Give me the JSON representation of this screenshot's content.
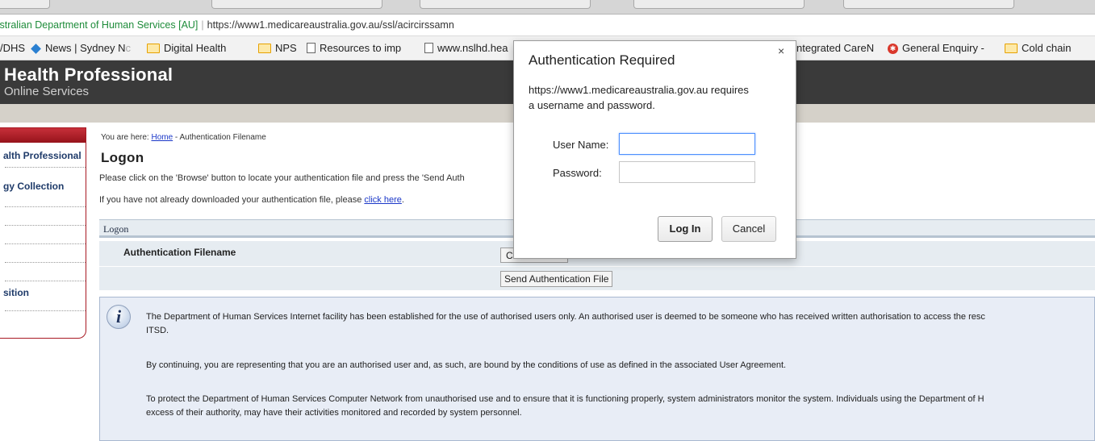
{
  "browser": {
    "site_identity": "ıstralian Department of Human Services [AU]",
    "url": "https://www1.medicareaustralia.gov.au/ssl/acircirssamn",
    "bookmarks": [
      {
        "label": "/DHS",
        "icon": "none"
      },
      {
        "label": "News | Sydney N",
        "fade": "c",
        "icon": "news-diamond-icon"
      },
      {
        "label": "Digital Health",
        "icon": "folder-icon"
      },
      {
        "label": "NPS",
        "icon": "folder-icon"
      },
      {
        "label": "Resources to imp",
        "icon": "page-icon"
      },
      {
        "label": "www.nslhd.hea",
        "icon": "page-icon"
      },
      {
        "label": "ntegrated CareN",
        "icon": "none"
      },
      {
        "label": "General Enquiry -",
        "icon": "red-circle-icon"
      },
      {
        "label": "Cold chain",
        "icon": "folder-icon"
      }
    ]
  },
  "header": {
    "title": "Health Professional",
    "subtitle": "Online Services"
  },
  "leftnav": {
    "items": [
      "alth Professional",
      "gy Collection",
      "sition"
    ]
  },
  "main": {
    "breadcrumb_prefix": "You are here: ",
    "breadcrumb_home": "Home",
    "breadcrumb_rest": " - Authentication Filename",
    "page_title": "Logon",
    "instruction": "Please click on the 'Browse' button to locate your authentication file and press the 'Send Auth",
    "download_prefix": "If you have not already downloaded your authentication file, please ",
    "download_link": "click here",
    "download_suffix": ".",
    "logon_section": "Logon",
    "auth_filename_label": "Authentication Filename",
    "choose_button": "C",
    "send_button": "Send Authentication File"
  },
  "info": {
    "icon": "info-icon",
    "para1_line1": "The Department of Human Services Internet facility has been established for the use of authorised users only. An authorised user is deemed to be someone who has received written authorisation to access the resc",
    "para1_line2": "ITSD.",
    "para2": "By continuing, you are representing that you are an authorised user and, as such, are bound by the conditions of use as defined in the associated User Agreement.",
    "para3_line1": "To protect the Department of Human Services Computer Network from unauthorised use and to ensure that it is functioning properly, system administrators monitor the system. Individuals using the Department of H",
    "para3_line2": "excess of their authority, may have their activities monitored and recorded by system personnel."
  },
  "dialog": {
    "title": "Authentication Required",
    "close": "×",
    "message_line1": "https://www1.medicareaustralia.gov.au requires",
    "message_line2": "a username and password.",
    "username_label": "User Name:",
    "password_label": "Password:",
    "username_value": "",
    "password_value": "",
    "login_button": "Log In",
    "cancel_button": "Cancel"
  }
}
